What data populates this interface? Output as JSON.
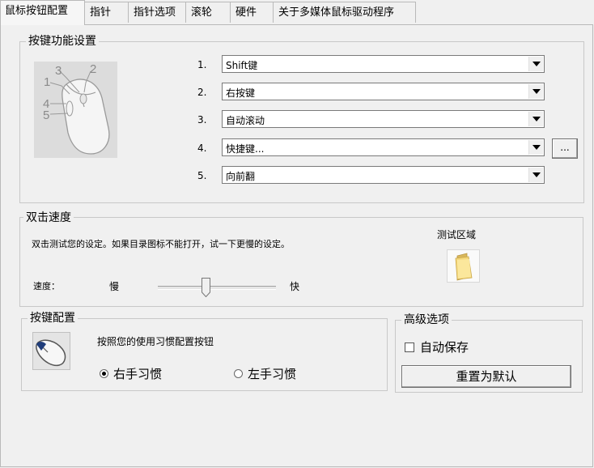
{
  "tabs": [
    {
      "label": "鼠标按钮配置"
    },
    {
      "label": "指针"
    },
    {
      "label": "指针选项"
    },
    {
      "label": "滚轮"
    },
    {
      "label": "硬件"
    },
    {
      "label": "关于多媒体鼠标驱动程序"
    }
  ],
  "buttons_group": {
    "title": "按键功能设置",
    "diagram_numbers": [
      "1",
      "2",
      "3",
      "4",
      "5"
    ],
    "rows": [
      {
        "num": "1.",
        "value": "Shift键"
      },
      {
        "num": "2.",
        "value": "右按键"
      },
      {
        "num": "3.",
        "value": "自动滚动"
      },
      {
        "num": "4.",
        "value": "快捷键..."
      },
      {
        "num": "5.",
        "value": "向前翻"
      }
    ],
    "browse_label": "..."
  },
  "double_click": {
    "title": "双击速度",
    "description": "双击测试您的设定。如果目录图标不能打开，试一下更慢的设定。",
    "test_area_label": "测试区域",
    "speed_label": "速度：",
    "slow_label": "慢",
    "fast_label": "快",
    "slider_level": 0.4
  },
  "button_config": {
    "title": "按键配置",
    "description": "按照您的使用习惯配置按钮",
    "right_hand": "右手习惯",
    "left_hand": "左手习惯",
    "selected": "right"
  },
  "advanced": {
    "title": "高级选项",
    "autosave_label": "自动保存",
    "autosave_checked": false,
    "reset_label": "重置为默认"
  }
}
